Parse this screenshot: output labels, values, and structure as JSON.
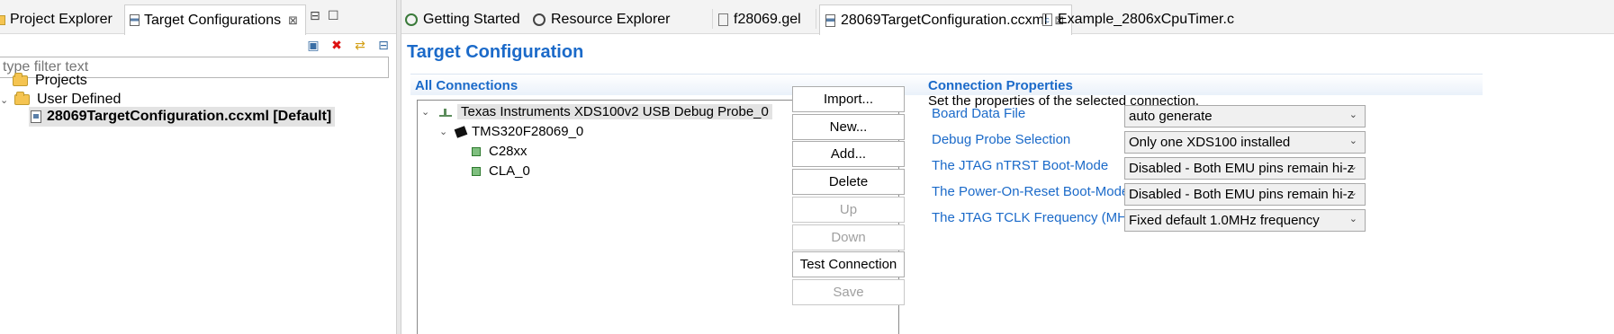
{
  "left_pane": {
    "tabs": [
      {
        "label": "Project Explorer"
      },
      {
        "label": "Target Configurations",
        "close": "⊠"
      }
    ],
    "minimize_glyph": "⊟",
    "maximize_glyph": "☐",
    "filter_placeholder": "type filter text",
    "tree": {
      "projects": "Projects",
      "user_defined": "User Defined",
      "file": "28069TargetConfiguration.ccxml [Default]"
    }
  },
  "editor": {
    "tabs": [
      {
        "label": "Getting Started"
      },
      {
        "label": "Resource Explorer"
      },
      {
        "label": "f28069.gel"
      },
      {
        "label": "28069TargetConfiguration.ccxml",
        "close": "⊠"
      },
      {
        "label": "Example_2806xCpuTimer.c"
      }
    ],
    "title": "Target Configuration",
    "connections": {
      "heading": "All Connections",
      "tree": {
        "probe": "Texas Instruments XDS100v2 USB Debug Probe_0",
        "device": "TMS320F28069_0",
        "core1": "C28xx",
        "core2": "CLA_0"
      },
      "buttons": {
        "import_label": "Import...",
        "new_label": "New...",
        "add_label": "Add...",
        "delete_label": "Delete",
        "up_label": "Up",
        "down_label": "Down",
        "test_label": "Test Connection",
        "save_label": "Save"
      }
    },
    "properties": {
      "heading": "Connection Properties",
      "description": "Set the properties of the selected connection.",
      "rows": [
        {
          "label": "Board Data File",
          "value": "auto generate"
        },
        {
          "label": "Debug Probe Selection",
          "value": "Only one XDS100 installed"
        },
        {
          "label": "The JTAG nTRST Boot-Mode",
          "value": "Disabled - Both EMU pins remain hi-z"
        },
        {
          "label": "The Power-On-Reset Boot-Mode",
          "value": "Disabled - Both EMU pins remain hi-z"
        },
        {
          "label": "The JTAG TCLK Frequency (MHz)",
          "value": "Fixed default 1.0MHz frequency"
        }
      ]
    }
  },
  "colors": {
    "accent": "#1b6ac9",
    "selection": "#e3e3e3"
  }
}
